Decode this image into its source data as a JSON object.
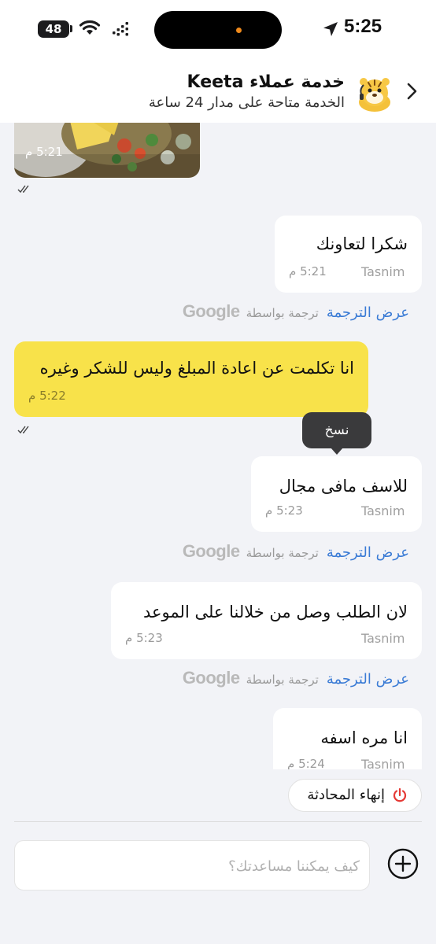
{
  "status_bar": {
    "battery": "48",
    "time": "5:25"
  },
  "header": {
    "title": "خدمة عملاء Keeta",
    "subtitle": "الخدمة متاحة على مدار 24 ساعة"
  },
  "messages": [
    {
      "type": "image",
      "side": "left",
      "time": "5:21 م",
      "read": true
    },
    {
      "type": "text",
      "side": "right",
      "sender": "Tasnim",
      "text": "شكرا لتعاونك",
      "time": "5:21 م",
      "translate": true
    },
    {
      "type": "text",
      "side": "left",
      "highlight": true,
      "text": "انا تكلمت عن اعادة المبلغ وليس للشكر وغيره",
      "time": "5:22 م",
      "read": true
    },
    {
      "type": "text",
      "side": "right",
      "sender": "Tasnim",
      "text": "للاسف مافى مجال",
      "time": "5:23 م",
      "translate": true
    },
    {
      "type": "text",
      "side": "right",
      "sender": "Tasnim",
      "text": "لان الطلب وصل من خلالنا على الموعد",
      "time": "5:23 م",
      "translate": true
    },
    {
      "type": "text",
      "side": "right",
      "sender": "Tasnim",
      "text": "انا مره اسفه",
      "time": "5:24 م"
    }
  ],
  "translation": {
    "link": "عرض الترجمة",
    "by": "ترجمة بواسطة",
    "brand": "Google"
  },
  "tooltip": {
    "label": "نسخ"
  },
  "end_chat": {
    "label": "إنهاء المحادثة"
  },
  "composer": {
    "placeholder": "كيف يمكننا مساعدتك؟",
    "value": ""
  },
  "colors": {
    "highlight_bubble": "#f8e24a",
    "link": "#3a7bd5",
    "end_icon": "#e53935",
    "background": "#f2f3f7"
  },
  "icons": [
    "wifi-icon",
    "cellular-icon",
    "location-arrow-icon",
    "chevron-right-icon",
    "tiger-avatar-icon",
    "double-check-icon",
    "power-icon",
    "plus-circle-icon"
  ]
}
